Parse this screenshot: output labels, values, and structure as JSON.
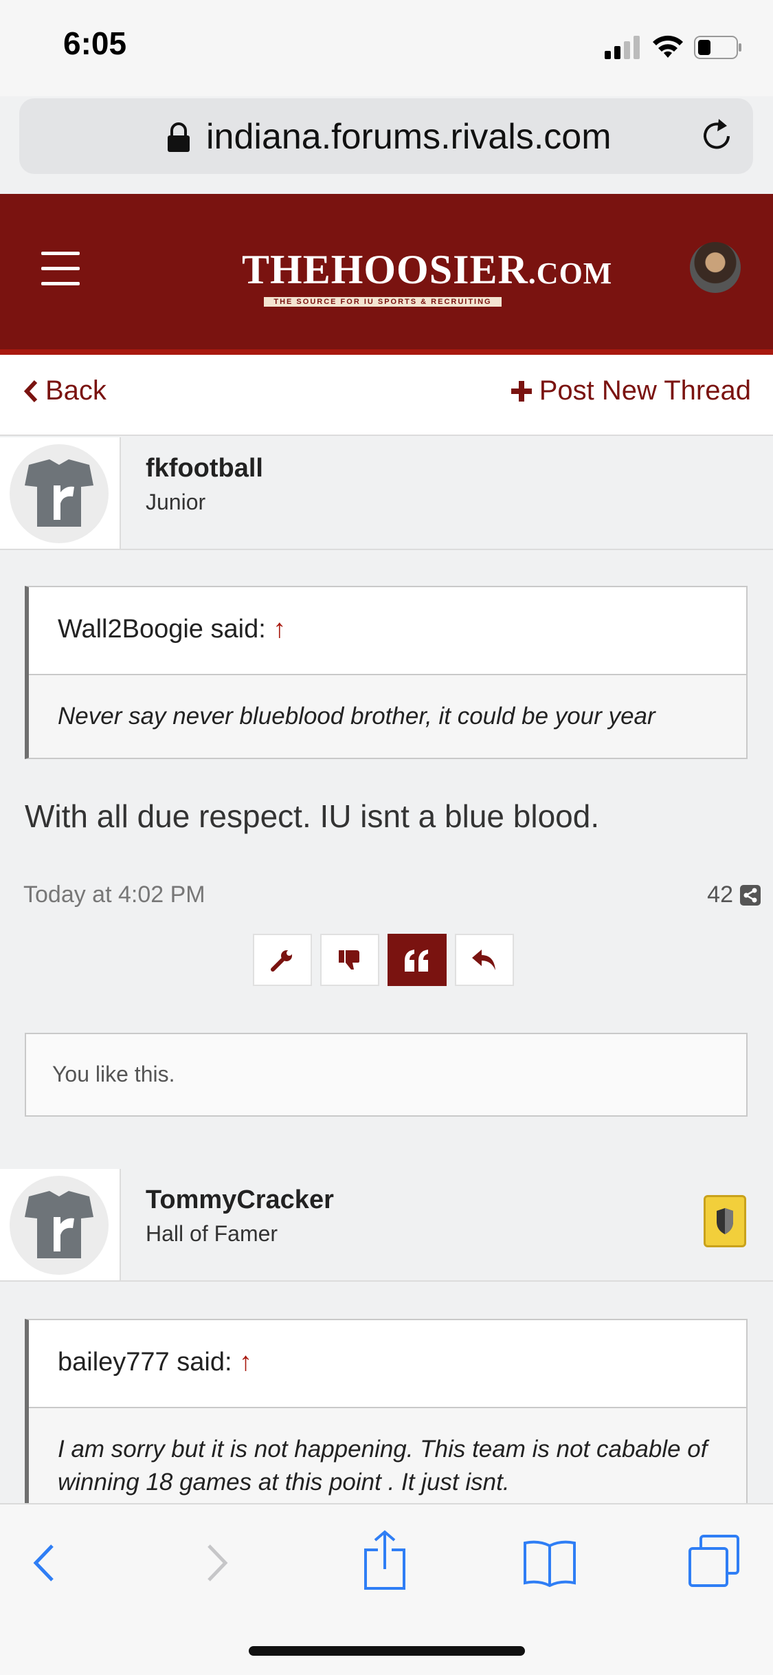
{
  "status_bar": {
    "time": "6:05"
  },
  "browser": {
    "url": "indiana.forums.rivals.com"
  },
  "site": {
    "logo_main_a": "THE",
    "logo_main_b": "HOOSIER",
    "logo_main_c": ".COM",
    "logo_tagline": "THE SOURCE FOR IU SPORTS & RECRUITING"
  },
  "nav": {
    "back_label": "Back",
    "new_thread_label": "Post New Thread"
  },
  "posts": [
    {
      "username": "fkfootball",
      "rank": "Junior",
      "quote_author": "Wall2Boogie said:",
      "quote_text": "Never say never blueblood brother, it could be your year",
      "message": "With all due respect. IU isnt a blue blood.",
      "date": "Today at 4:02 PM",
      "count": "42",
      "like_text": "You like this."
    },
    {
      "username": "TommyCracker",
      "rank": "Hall of Famer",
      "quote_author": "bailey777 said:",
      "quote_text": "I am sorry but it is not happening. This team is not cabable of winning 18 games at this point . It just isnt."
    }
  ],
  "colors": {
    "brand": "#7a1310",
    "accent": "#a8190f",
    "badge": "#f2cf3b"
  },
  "icons": [
    "lock-icon",
    "reload-icon",
    "hamburger-icon",
    "back-chevron-icon",
    "plus-icon",
    "share-icon",
    "wrench-icon",
    "thumbs-down-icon",
    "quote-icon",
    "reply-icon",
    "shield-badge-icon"
  ]
}
